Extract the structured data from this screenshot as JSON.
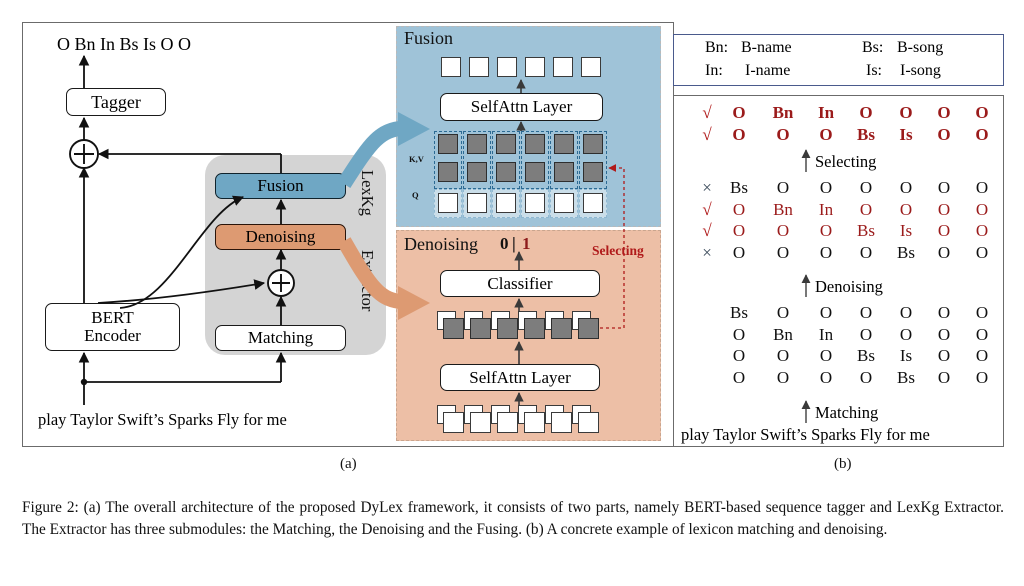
{
  "figure": {
    "caption": "Figure 2: (a) The overall architecture of the proposed DyLex framework, it consists of two parts, namely BERT-based sequence tagger and LexKg Extractor. The Extractor has three submodules: the Matching, the Denoising and the Fusing. (b) A concrete example of lexicon matching and denoising.",
    "sublabel_a": "(a)",
    "sublabel_b": "(b)"
  },
  "colors": {
    "fusion_panel_bg": "#9fc3d8",
    "denoising_panel_bg": "#edbfa6",
    "fusion_box": "#6fa7c4",
    "denoising_box": "#dd9a72",
    "grey_region": "#d4d4d4",
    "grey_square": "#7d7d7d",
    "selecting_red": "#b01a1a",
    "tag_red": "#9b1b1b",
    "legend_border": "#4a5a8c",
    "frame_border": "#6b6b6b"
  },
  "panel_a": {
    "output_tags": "O Bn In Bs Is O O",
    "input_sentence": "play Taylor Swift’s Sparks Fly for me",
    "boxes": {
      "tagger": "Tagger",
      "bert_encoder_line1": "BERT",
      "bert_encoder_line2": "Encoder",
      "fusion": "Fusion",
      "denoising": "Denoising",
      "matching": "Matching"
    },
    "region_label_line1": "LexKg",
    "region_label_line2": "Extractor",
    "adder_symbol": "+"
  },
  "fusion_panel": {
    "title": "Fusion",
    "selfattn_label": "SelfAttn Layer",
    "kv_label": "K,V",
    "q_label": "Q",
    "columns": 6,
    "kv_rows": 2
  },
  "denoising_panel": {
    "title": "Denoising",
    "logits_zero": "0",
    "logits_sep": "|",
    "logits_one": "1",
    "classifier_label": "Classifier",
    "selfattn_label": "SelfAttn Layer",
    "selecting_label": "Selecting",
    "columns": 6
  },
  "panel_b": {
    "legend": [
      {
        "abbr": "Bn:",
        "full": "B-name"
      },
      {
        "abbr": "Bs:",
        "full": "B-song"
      },
      {
        "abbr": "In:",
        "full": "I-name"
      },
      {
        "abbr": "Is:",
        "full": "I-song"
      }
    ],
    "arrow_labels": {
      "selecting": "Selecting",
      "denoising": "Denoising",
      "matching": "Matching"
    },
    "sentence": "play Taylor Swift’s Sparks Fly for me",
    "final_rows": [
      {
        "mark": "√",
        "mark_color": "red",
        "color": "red",
        "bold": true,
        "tags": [
          "O",
          "Bn",
          "In",
          "O",
          "O",
          "O",
          "O"
        ]
      },
      {
        "mark": "√",
        "mark_color": "red",
        "color": "red",
        "bold": true,
        "tags": [
          "O",
          "O",
          "O",
          "Bs",
          "Is",
          "O",
          "O"
        ]
      }
    ],
    "denoised_rows": [
      {
        "mark": "×",
        "mark_color": "dark",
        "color": "black",
        "bold": false,
        "tags": [
          "Bs",
          "O",
          "O",
          "O",
          "O",
          "O",
          "O"
        ]
      },
      {
        "mark": "√",
        "mark_color": "red",
        "color": "red",
        "bold": false,
        "tags": [
          "O",
          "Bn",
          "In",
          "O",
          "O",
          "O",
          "O"
        ]
      },
      {
        "mark": "√",
        "mark_color": "red",
        "color": "red",
        "bold": false,
        "tags": [
          "O",
          "O",
          "O",
          "Bs",
          "Is",
          "O",
          "O"
        ]
      },
      {
        "mark": "×",
        "mark_color": "dark",
        "color": "black",
        "bold": false,
        "tags": [
          "O",
          "O",
          "O",
          "O",
          "Bs",
          "O",
          "O"
        ]
      }
    ],
    "matched_rows": [
      {
        "mark": "",
        "color": "black",
        "bold": false,
        "tags": [
          "Bs",
          "O",
          "O",
          "O",
          "O",
          "O",
          "O"
        ]
      },
      {
        "mark": "",
        "color": "black",
        "bold": false,
        "tags": [
          "O",
          "Bn",
          "In",
          "O",
          "O",
          "O",
          "O"
        ]
      },
      {
        "mark": "",
        "color": "black",
        "bold": false,
        "tags": [
          "O",
          "O",
          "O",
          "Bs",
          "Is",
          "O",
          "O"
        ]
      },
      {
        "mark": "",
        "color": "black",
        "bold": false,
        "tags": [
          "O",
          "O",
          "O",
          "O",
          "Bs",
          "O",
          "O"
        ]
      }
    ]
  }
}
